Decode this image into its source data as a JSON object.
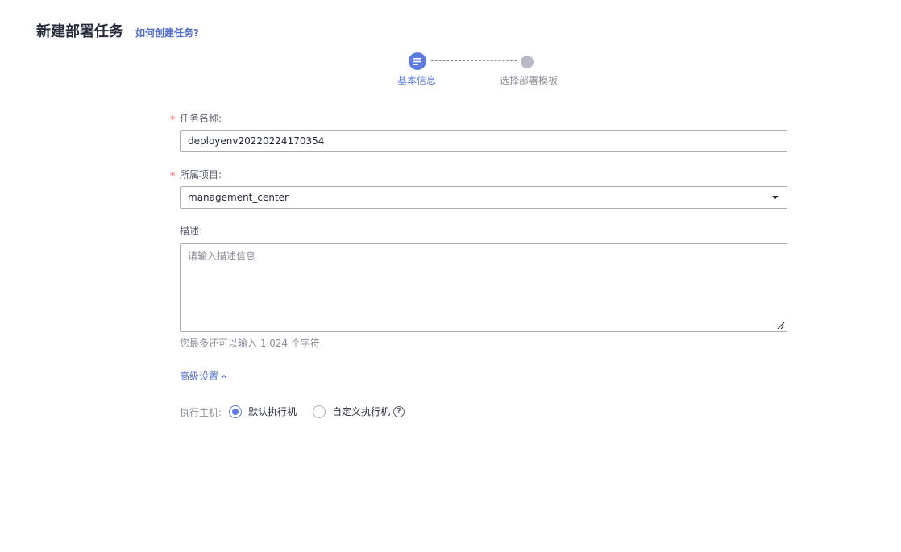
{
  "header": {
    "title": "新建部署任务",
    "help_link": "如何创建任务?"
  },
  "stepper": {
    "steps": [
      {
        "label": "基本信息",
        "state": "active"
      },
      {
        "label": "选择部署模板",
        "state": "inactive"
      }
    ]
  },
  "form": {
    "required_mark": "*",
    "task_name": {
      "label": "任务名称:",
      "value": "deployenv20220224170354"
    },
    "project": {
      "label": "所属项目:",
      "value": "management_center"
    },
    "description": {
      "label": "描述:",
      "placeholder": "请输入描述信息",
      "char_hint": "您最多还可以输入 1,024 个字符"
    },
    "advanced": {
      "label": "高级设置"
    },
    "exec_host": {
      "label": "执行主机:",
      "options": [
        {
          "label": "默认执行机",
          "checked": true
        },
        {
          "label": "自定义执行机",
          "checked": false
        }
      ],
      "help": "?"
    }
  },
  "colors": {
    "primary": "#5e7ce0",
    "link": "#526ecc",
    "required": "#f66f6a",
    "border": "#adb0b8"
  }
}
